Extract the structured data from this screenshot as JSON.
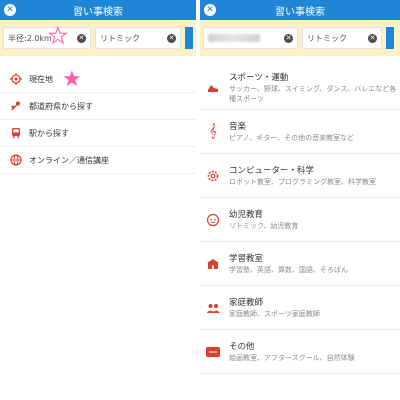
{
  "left": {
    "title": "習い事検索",
    "chips": [
      {
        "label": "半径:2.0km"
      },
      {
        "label": "リトミック"
      }
    ],
    "menu": [
      {
        "label": "現在地",
        "icon": "location-target-icon"
      },
      {
        "label": "都道府県から探す",
        "icon": "map-pin-icon"
      },
      {
        "label": "駅から探す",
        "icon": "train-icon"
      },
      {
        "label": "オンライン／通信講座",
        "icon": "globe-icon"
      }
    ]
  },
  "right": {
    "title": "習い事検索",
    "chips": [
      {
        "label": ""
      },
      {
        "label": "リトミック"
      }
    ],
    "categories": [
      {
        "title": "スポーツ・運動",
        "sub": "サッカー、野球、スイミング、ダンス、バレエなど各種スポーツ",
        "icon": "sneaker-icon"
      },
      {
        "title": "音楽",
        "sub": "ピアノ、ギター、その他の音楽教室など",
        "icon": "treble-clef-icon"
      },
      {
        "title": "コンピューター・科学",
        "sub": "ロボット教室、プログラミング教室、科学教室",
        "icon": "gear-icon"
      },
      {
        "title": "幼児教育",
        "sub": "リトミック、幼児教育",
        "icon": "baby-face-icon"
      },
      {
        "title": "学習教室",
        "sub": "学習塾、英語、算数、国語、そろばん",
        "icon": "school-icon"
      },
      {
        "title": "家庭教師",
        "sub": "家庭教師、スポーツ家庭教師",
        "icon": "tutor-icon"
      },
      {
        "title": "その他",
        "sub": "絵画教室、アフタースクール、自然体験",
        "icon": "other-badge-icon"
      }
    ]
  },
  "colors": {
    "header": "#1f86d6",
    "filter_bg": "#fdf1c5",
    "icon_red": "#d9412e",
    "star_pink": "#ff5fa8"
  }
}
